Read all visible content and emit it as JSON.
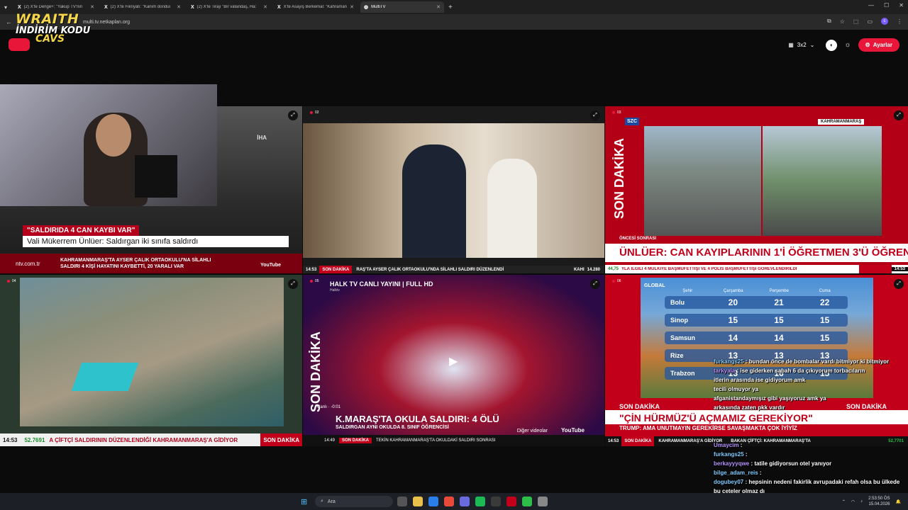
{
  "browser": {
    "tabs": [
      {
        "label": "(2) X'te Denge+: \"Yakup TV'nin",
        "active": false
      },
      {
        "label": "(2) X'te Fikriyatı: \"Kanım donduı",
        "active": false
      },
      {
        "label": "(2) X'te Tirajı \"Bir vatandaş, Ha:",
        "active": false
      },
      {
        "label": "X'te Asayiş Berkemal: \"Kahraman",
        "active": false
      },
      {
        "label": "MultiTV",
        "active": true
      }
    ],
    "url": "multi.tv.netkaplan.org"
  },
  "overlay": {
    "brand": "WRAITH",
    "promo_line1": "İNDİRİM KODU",
    "promo_line2": "CAVS"
  },
  "toolbar": {
    "layout_label": "3x2",
    "settings_label": "Ayarlar"
  },
  "tiles": {
    "t1": {
      "banner": "\"SALDIRIDA 4 CAN KAYBI VAR\"",
      "caption": "Vali Mükerrem Ünlüer: Saldırgan iki sınıfa saldırdı",
      "channel": "ntv.com.tr",
      "ticker1": "KAHRAMANMARAŞ'TA AYSER ÇALIK ORTAOKULU'NA SİLAHLI",
      "ticker2": "SALDIRI 4 KİŞİ HAYATINI KAYBETTİ, 20 YARALI VAR",
      "iha": "İHA",
      "youtube": "YouTube",
      "more": "Diğer videolar"
    },
    "t2": {
      "num": "02",
      "time": "14:53",
      "tag": "SON DAKİKA",
      "ticker": "RAŞ'TA AYSER ÇALIK ORTAOKULU'NDA SİLAHLI SALDIRI DÜZENLENDİ",
      "market": "KAHI",
      "value": "14.280"
    },
    "t3": {
      "num": "03",
      "logo": "SZC",
      "side": "SON DAKİKA",
      "location": "KAHRAMANMARAŞ",
      "label": "ÖNCESİ SONRASI",
      "headline": "ÜNLÜER: CAN KAYIPLARININ 1'İ ÖĞRETMEN 3'Ü ÖĞRENCİ",
      "ticker_value": "44,75",
      "ticker": "YLA İLGİLİ 4 MÜLKİYE BAŞMÜFETTİŞİ VE 4 POLİS BAŞMÜFETTİŞİ GÖREVLENDİRİLDİ",
      "tag": "SON DAKİKA",
      "time": "14:53"
    },
    "t4": {
      "num": "04",
      "time": "14:53",
      "value": "52.7691",
      "ticker": "A ÇİFTÇİ SALDIRININ DÜZENLENDİĞİ KAHRAMANMARAŞ'A GİDİYOR",
      "tag": "SON DAKİKA"
    },
    "t5": {
      "num": "05",
      "title": "HALK TV CANLI YAYINI | FULL HD",
      "subtitle": "Halktv",
      "side": "SON DAKİKA",
      "live": "Canlı · -0:01",
      "headline": "K.MARAŞ'TA OKULA SALDIRI: 4 ÖLÜ",
      "subline": "SALDIRGAN AYNI OKULDA 8. SINIF ÖĞRENCİSİ",
      "time": "14:49",
      "tag": "SON DAKİKA",
      "ticker": "TEKİN KAHRAMANMARAŞ'TA OKULDAKİ SALDIRI SONRASI",
      "more": "Diğer videolar",
      "youtube": "YouTube"
    },
    "t6": {
      "num": "06",
      "global": "GLOBAL",
      "weather_headers": [
        "Şehir",
        "Çarşamba",
        "Perşembe",
        "Cuma"
      ],
      "weather": [
        {
          "city": "Bolu",
          "d1": "20",
          "d2": "21",
          "d3": "22"
        },
        {
          "city": "Sinop",
          "d1": "15",
          "d2": "15",
          "d3": "15"
        },
        {
          "city": "Samsun",
          "d1": "14",
          "d2": "14",
          "d3": "15"
        },
        {
          "city": "Rize",
          "d1": "13",
          "d2": "13",
          "d3": "13"
        },
        {
          "city": "Trabzon",
          "d1": "13",
          "d2": "16",
          "d3": "15"
        }
      ],
      "sd_left": "SON DAKİKA",
      "sd_right": "SON DAKİKA",
      "headline": "\"ÇİN HÜRMÜZ'Ü AÇMAMIZ GEREKİYOR\"",
      "subline": "TRUMP: AMA UNUTMAYIN GEREKİRSE SAVAŞMAKTA ÇOK İYİYİZ",
      "time": "14:53",
      "tag": "SON DAKİKA",
      "ticker": "KAHRAMANMARAŞ'A GİDİYOR",
      "ticker2": "BAKAN ÇİFTÇİ: KAHRAMANMARAŞ'TA",
      "value": "52,7701"
    }
  },
  "chat": {
    "top": [
      {
        "user": "furkangs25",
        "text": "bundan önce de bombalar vardı bitmiyor ki bitmiyor",
        "color": "#7ecbff"
      },
      {
        "user": "tarkyala",
        "text": "ise giderken sabah 6 da çıkıyorum torbacıların",
        "color": "#b692ff"
      },
      {
        "user": "",
        "text": "itlerin arasında ise gidiyorum amk",
        "color": "#fff"
      },
      {
        "user": "",
        "text": "tecili olmuyor ya",
        "color": "#fff"
      },
      {
        "user": "",
        "text": "afganistandaymışız gibi yaşıyoruz amk ya",
        "color": "#fff"
      },
      {
        "user": "",
        "text": "arkasında zaten pkk vardır",
        "color": "#fff"
      }
    ],
    "bottom": [
      {
        "user": "Umaycim",
        "text": "",
        "color": "#b692ff"
      },
      {
        "user": "furkangs25",
        "text": "",
        "color": "#7ecbff"
      },
      {
        "user": "berkayyyqwe",
        "text": "tatile gidiyorsun otel yanıyor",
        "color": "#b692ff"
      },
      {
        "user": "bilge_adam_reis",
        "text": "",
        "color": "#7ecbff"
      },
      {
        "user": "dogubey07",
        "text": "hepsinin nedeni fakirlik avrupadaki refah olsa bu ülkede bu çeteler olmaz dı",
        "color": "#7ecbff"
      }
    ]
  },
  "taskbar": {
    "search": "Ara",
    "time": "2:53:50 ÖS",
    "date": "15.04.2026"
  }
}
